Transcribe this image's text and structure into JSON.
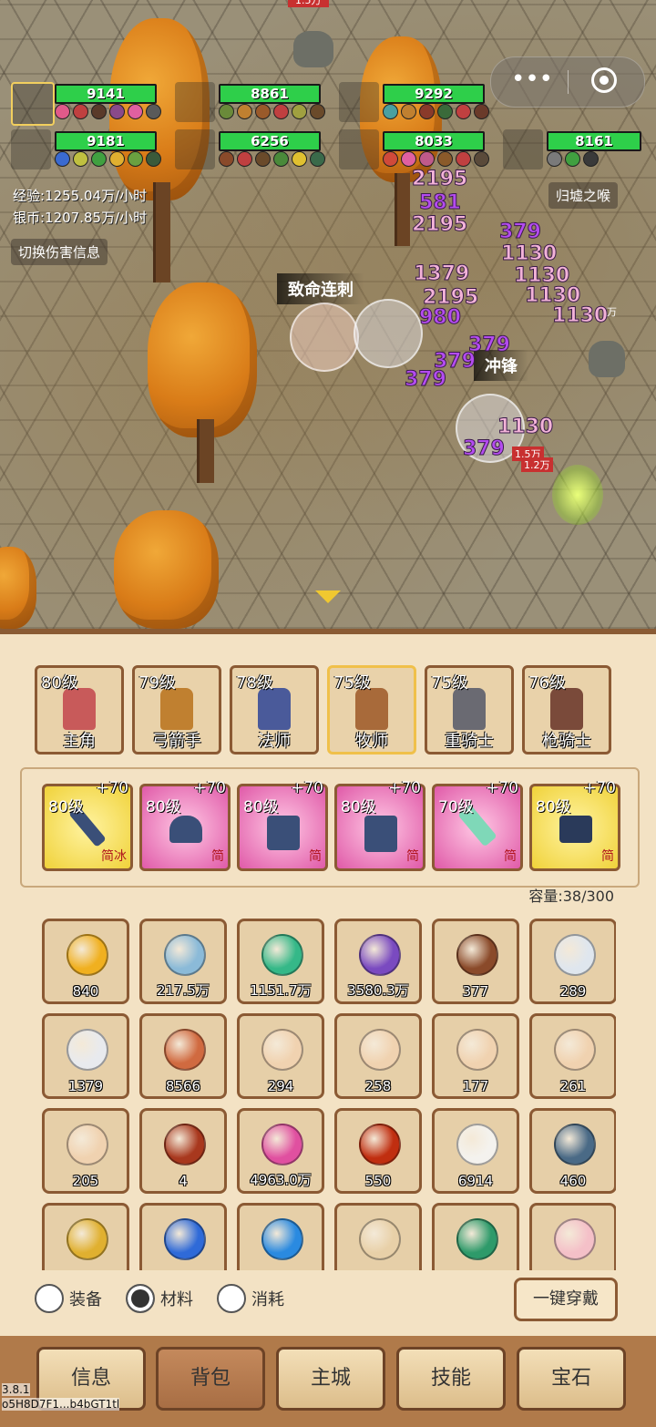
{
  "party": [
    {
      "hp": "9141",
      "selected": true
    },
    {
      "hp": "8861"
    },
    {
      "hp": "9292"
    },
    {
      "hp": "9181"
    },
    {
      "hp": "6256"
    },
    {
      "hp": "8033"
    },
    {
      "hp": "8161"
    }
  ],
  "stats": {
    "exp": "经验:1255.04万/小时",
    "silver": "银币:1207.85万/小时",
    "toggle_damage": "切换伤害信息",
    "location": "归墟之喉"
  },
  "top_fragment": "1.5万",
  "damage_numbers": [
    {
      "t": "2195",
      "c": "pink"
    },
    {
      "t": "581",
      "c": "purple"
    },
    {
      "t": "2195",
      "c": "pink"
    },
    {
      "t": "379",
      "c": "purple"
    },
    {
      "t": "1130",
      "c": "pink"
    },
    {
      "t": "1130",
      "c": "pink"
    },
    {
      "t": "1379",
      "c": "pink"
    },
    {
      "t": "1130",
      "c": "pink"
    },
    {
      "t": "2195",
      "c": "pink"
    },
    {
      "t": "980",
      "c": "purple"
    },
    {
      "t": "1130",
      "c": "pink"
    },
    {
      "t": "379",
      "c": "purple"
    },
    {
      "t": "379",
      "c": "purple"
    },
    {
      "t": "379",
      "c": "purple"
    },
    {
      "t": "1130",
      "c": "pink"
    },
    {
      "t": "379",
      "c": "purple"
    }
  ],
  "skills": {
    "fatal": "致命连刺",
    "charge": "冲锋"
  },
  "small_labels": {
    "a": "1.5万",
    "b": "1.2万",
    "c": "万"
  },
  "heroes": [
    {
      "level": "80级",
      "name": "主角"
    },
    {
      "level": "79级",
      "name": "弓箭手"
    },
    {
      "level": "78级",
      "name": "法师"
    },
    {
      "level": "75级",
      "name": "牧师",
      "selected": true
    },
    {
      "level": "75级",
      "name": "重骑士"
    },
    {
      "level": "76级",
      "name": "枪骑士"
    }
  ],
  "equipment": [
    {
      "level": "80级",
      "plus": "+70",
      "tag": "简冰",
      "bg": "#f0d23a"
    },
    {
      "level": "80级",
      "plus": "+70",
      "tag": "简",
      "bg": "#e05aa8"
    },
    {
      "level": "80级",
      "plus": "+70",
      "tag": "简",
      "bg": "#e05aa8"
    },
    {
      "level": "80级",
      "plus": "+70",
      "tag": "简",
      "bg": "#e05aa8"
    },
    {
      "level": "70级",
      "plus": "+70",
      "tag": "简",
      "bg": "#e05aa8"
    },
    {
      "level": "80级",
      "plus": "+70",
      "tag": "简",
      "bg": "#f0d23a"
    }
  ],
  "capacity": "容量:38/300",
  "items": [
    {
      "count": "840",
      "icon": "gold-coin-icon",
      "color": "#f0b020"
    },
    {
      "count": "217.5万",
      "icon": "silver-coin-icon",
      "color": "#8bbad8"
    },
    {
      "count": "1151.7万",
      "icon": "green-orb-icon",
      "color": "#35b888"
    },
    {
      "count": "3580.3万",
      "icon": "purple-crystal-icon",
      "color": "#7a4ac0"
    },
    {
      "count": "377",
      "icon": "wood-icon",
      "color": "#8a4a2a"
    },
    {
      "count": "289",
      "icon": "fang-icon",
      "color": "#dfe6ee"
    },
    {
      "count": "1379",
      "icon": "feather-icon",
      "color": "#e8eaee"
    },
    {
      "count": "8566",
      "icon": "ore-icon",
      "color": "#d06a40"
    },
    {
      "count": "294",
      "icon": "scroll-icon",
      "color": "#f0d2b0"
    },
    {
      "count": "258",
      "icon": "scroll-icon",
      "color": "#f0d2b0"
    },
    {
      "count": "177",
      "icon": "scroll-icon",
      "color": "#f0d2b0"
    },
    {
      "count": "261",
      "icon": "scroll-icon",
      "color": "#f0d2b0"
    },
    {
      "count": "205",
      "icon": "scroll-icon",
      "color": "#f0d2b0"
    },
    {
      "count": "4",
      "icon": "fire-orb-icon",
      "color": "#a8381e"
    },
    {
      "count": "4963.0万",
      "icon": "pink-gem-icon",
      "color": "#e050a0"
    },
    {
      "count": "550",
      "icon": "lava-orb-icon",
      "color": "#c02e10"
    },
    {
      "count": "6914",
      "icon": "tooth-icon",
      "color": "#f4f2ee"
    },
    {
      "count": "460",
      "icon": "shield-icon",
      "color": "#4a6a86"
    },
    {
      "count": "",
      "icon": "key-icon",
      "color": "#e0b030"
    },
    {
      "count": "",
      "icon": "blue-ore-icon",
      "color": "#2f6ad8"
    },
    {
      "count": "",
      "icon": "sapphire-icon",
      "color": "#2a8ae0"
    },
    {
      "count": "",
      "icon": "bone-icon",
      "color": "#e8d0a8"
    },
    {
      "count": "",
      "icon": "eye-icon",
      "color": "#2e9a6a"
    },
    {
      "count": "",
      "icon": "ice-cream-icon",
      "color": "#f4c0c8"
    }
  ],
  "filters": [
    {
      "label": "装备",
      "selected": false
    },
    {
      "label": "材料",
      "selected": true
    },
    {
      "label": "消耗",
      "selected": false
    }
  ],
  "wear_button": "一键穿戴",
  "nav": [
    {
      "label": "信息"
    },
    {
      "label": "背包",
      "active": true
    },
    {
      "label": "主城"
    },
    {
      "label": "技能"
    },
    {
      "label": "宝石"
    }
  ],
  "version": "3.8.1",
  "user_id": "o5H8D7F1...b4bGT1tl"
}
